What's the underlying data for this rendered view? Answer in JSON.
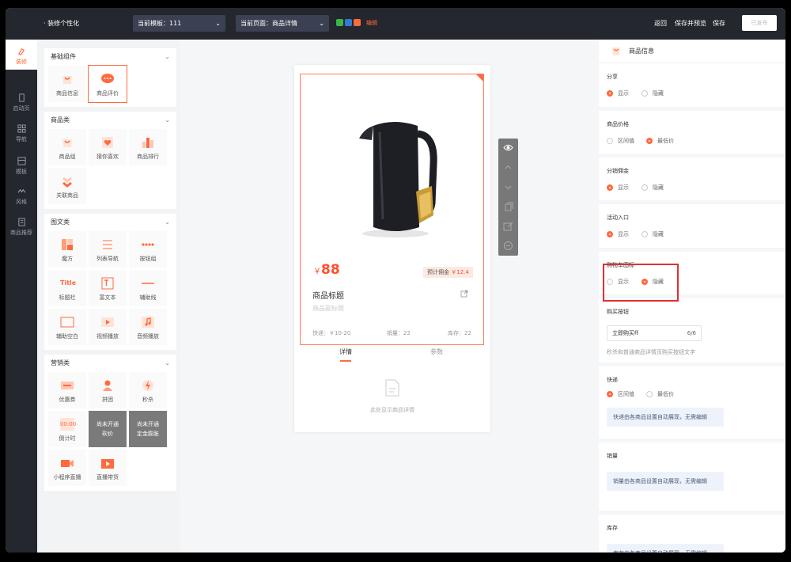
{
  "topbar": {
    "title": "· 装修个性化",
    "template_select": "当前模板：111",
    "page_select": "当前页面：商品详情",
    "edit_label": "编辑",
    "back": "返回",
    "save_preview": "保存并预览",
    "save": "保存",
    "publish": "已发布"
  },
  "rail": [
    {
      "label": "装修",
      "icon": "brush-icon"
    },
    {
      "label": "启动页",
      "icon": "phone-icon"
    },
    {
      "label": "导航",
      "icon": "grid-icon"
    },
    {
      "label": "模板",
      "icon": "template-icon"
    },
    {
      "label": "风格",
      "icon": "palette-icon"
    },
    {
      "label": "商品推荐",
      "icon": "list-icon"
    }
  ],
  "library": {
    "groups": [
      {
        "title": "基础组件",
        "items": [
          {
            "label": "商品信息"
          },
          {
            "label": "商品评价"
          }
        ]
      },
      {
        "title": "商品类",
        "items": [
          {
            "label": "商品组"
          },
          {
            "label": "猜你喜欢"
          },
          {
            "label": "商品排行"
          },
          {
            "label": "关联商品"
          }
        ]
      },
      {
        "title": "图文类",
        "items": [
          {
            "label": "魔方"
          },
          {
            "label": "列表导航"
          },
          {
            "label": "按钮组"
          },
          {
            "label": "标题栏"
          },
          {
            "label": "富文本"
          },
          {
            "label": "辅助线"
          },
          {
            "label": "辅助空白"
          },
          {
            "label": "视频播放"
          },
          {
            "label": "音频播放"
          }
        ]
      },
      {
        "title": "营销类",
        "items": [
          {
            "label": "优惠券"
          },
          {
            "label": "拼团"
          },
          {
            "label": "秒杀"
          },
          {
            "label": "倒计时"
          },
          {
            "label": "尚未开通",
            "sub": "砍价"
          },
          {
            "label": "尚未开通",
            "sub": "定金膨胀"
          },
          {
            "label": "小程序直播"
          },
          {
            "label": "直播带货"
          }
        ]
      }
    ],
    "icon_tile_text": "Title",
    "countdown_tile_text": "00:00"
  },
  "phone": {
    "price_symbol": "￥",
    "price": "88",
    "commission_label": "预计佣金",
    "commission_value": "￥12.4",
    "title": "商品标题",
    "subtitle": "商品副标题",
    "shipping": "快递：￥10-20",
    "sales": "销量：22",
    "stock": "库存：22",
    "tab_detail": "详情",
    "tab_params": "参数",
    "detail_tip": "此处显示商品详情"
  },
  "props": {
    "header": "商品信息",
    "sections": {
      "share": {
        "title": "分享",
        "opt1": "显示",
        "opt2": "隐藏"
      },
      "price": {
        "title": "商品价格",
        "opt1": "区间值",
        "opt2": "最低价"
      },
      "commission": {
        "title": "分销佣金",
        "opt1": "显示",
        "opt2": "隐藏"
      },
      "activity": {
        "title": "活动入口",
        "opt1": "显示",
        "opt2": "隐藏"
      },
      "cart_icon": {
        "title": "购物车图标",
        "opt1": "显示",
        "opt2": "隐藏"
      },
      "buy_button": {
        "title": "购买按钮",
        "value": "立即购买ff",
        "count": "6/6",
        "hint": "秒杀和普通商品详情页购买按钮文字"
      },
      "shipping": {
        "title": "快递",
        "opt1": "区间值",
        "opt2": "最低价",
        "info": "快递由各商品设置自动展现，无需编辑"
      },
      "sales": {
        "title": "销量",
        "info": "销量由各商品设置自动展现，无需编辑"
      },
      "stock": {
        "title": "库存",
        "info": "库存由各商品设置自动展现，无需编辑"
      }
    }
  },
  "colors": {
    "accent": "#ff6a3d",
    "dark": "#24272e",
    "highlight": "#e03030"
  }
}
